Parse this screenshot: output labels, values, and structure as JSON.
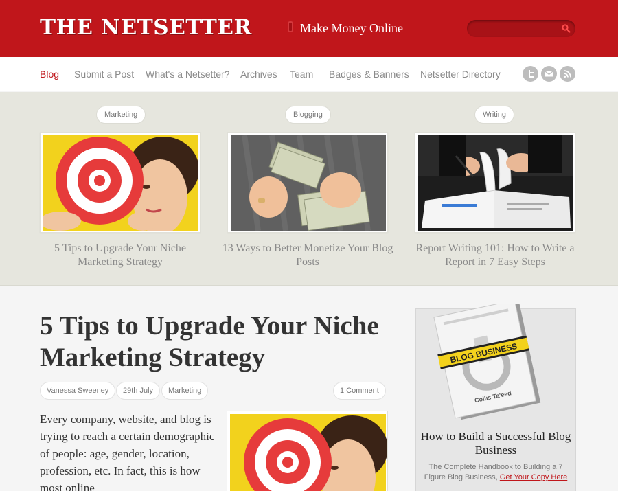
{
  "header": {
    "logo": "THE NETSETTER",
    "tagline": "Make Money Online",
    "search_placeholder": "",
    "brand_color": "#c0161b"
  },
  "nav": {
    "items": [
      {
        "label": "Blog",
        "active": true
      },
      {
        "label": "Submit a Post",
        "active": false
      },
      {
        "label": "What's a Netsetter?",
        "active": false
      },
      {
        "label": "Archives",
        "active": false
      },
      {
        "label": "Team",
        "active": false
      },
      {
        "label": "Badges & Banners",
        "active": false
      },
      {
        "label": "Netsetter Directory",
        "active": false
      }
    ],
    "social": [
      "twitter-icon",
      "email-icon",
      "rss-icon"
    ]
  },
  "featured": [
    {
      "category": "Marketing",
      "title": "5 Tips to Upgrade Your Niche Marketing Strategy",
      "image": "target-woman-image"
    },
    {
      "category": "Blogging",
      "title": "13 Ways to Better Monetize Your Blog Posts",
      "image": "money-hands-image"
    },
    {
      "category": "Writing",
      "title": "Report Writing 101: How to Write a Report in 7 Easy Steps",
      "image": "report-pages-image"
    }
  ],
  "article": {
    "title": "5 Tips to Upgrade Your Niche Marketing Strategy",
    "author": "Vanessa Sweeney",
    "date": "29th July",
    "category": "Marketing",
    "comments": "1 Comment",
    "body": "Every company, website, and blog is trying to reach a certain demographic of people: age, gender, location, profession, etc. In fact, this is how most online"
  },
  "sidebar_ad": {
    "book_banner": "BLOG BUSINESS",
    "book_author": "Collis Ta'eed",
    "title": "How to Build a Successful Blog Business",
    "description": "The Complete Handbook to Building a 7 Figure Blog Business,",
    "link_label": "Get Your Copy Here"
  }
}
